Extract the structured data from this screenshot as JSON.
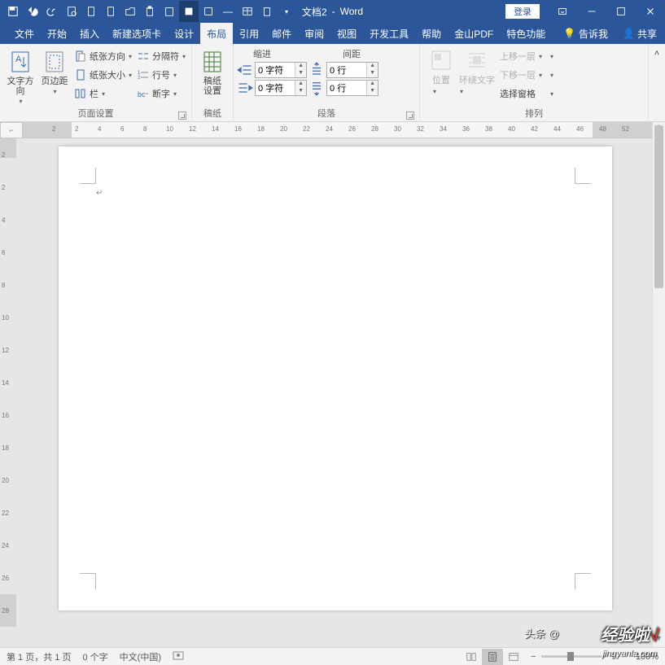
{
  "title": {
    "doc": "文档2",
    "app": "Word"
  },
  "titlebar": {
    "login": "登录"
  },
  "tabs": [
    "文件",
    "开始",
    "插入",
    "新建选项卡",
    "设计",
    "布局",
    "引用",
    "邮件",
    "审阅",
    "视图",
    "开发工具",
    "帮助",
    "金山PDF",
    "特色功能"
  ],
  "active_tab": 5,
  "tell_me": "告诉我",
  "share": "共享",
  "ribbon": {
    "g1": {
      "text_dir": "文字方向",
      "margins": "页边距",
      "orientation": "纸张方向",
      "size": "纸张大小",
      "columns": "栏",
      "breaks": "分隔符",
      "line_num": "行号",
      "hyphen": "断字",
      "label": "页面设置"
    },
    "g2": {
      "btn1": "稿纸",
      "btn2": "设置",
      "label": "稿纸"
    },
    "g3": {
      "indent_h": "缩进",
      "spacing_h": "间距",
      "left_v": "0 字符",
      "right_v": "0 字符",
      "before_v": "0 行",
      "after_v": "0 行",
      "label": "段落"
    },
    "g4": {
      "position": "位置",
      "wrap": "环绕文字",
      "bring_fwd": "上移一层",
      "send_back": "下移一层",
      "selection": "选择窗格",
      "label": "排列"
    }
  },
  "hruler_ticks": [
    2,
    2,
    4,
    6,
    8,
    10,
    12,
    14,
    16,
    18,
    20,
    22,
    24,
    26,
    28,
    30,
    32,
    34,
    36,
    38,
    40,
    42,
    44,
    46,
    48,
    52
  ],
  "vruler_ticks": [
    2,
    2,
    4,
    6,
    8,
    10,
    12,
    14,
    16,
    18,
    20,
    22,
    24,
    26,
    28
  ],
  "status": {
    "page": "第 1 页，共 1 页",
    "words": "0 个字",
    "lang": "中文(中国)",
    "zoom": "100%"
  },
  "watermark": {
    "head": "头条 @",
    "main": "经验啦",
    "sub": "jingyanla.com"
  }
}
